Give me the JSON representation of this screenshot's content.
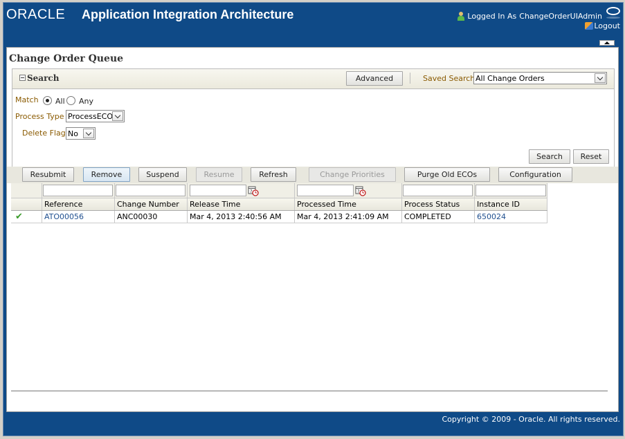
{
  "header": {
    "logo": "ORACLE",
    "app_title": "Application Integration Architecture",
    "logged_in_label": "Logged In As",
    "username": "ChangeOrderUIAdmin",
    "logout_label": "Logout"
  },
  "page": {
    "title": "Change Order Queue"
  },
  "search": {
    "title": "Search",
    "advanced_label": "Advanced",
    "saved_search_label": "Saved Search",
    "saved_search_value": "All Change Orders",
    "match_label": "Match",
    "match_options": [
      {
        "label": "All",
        "checked": true
      },
      {
        "label": "Any",
        "checked": false
      }
    ],
    "process_type_label": "Process Type",
    "process_type_value": "ProcessECO",
    "delete_flag_label": "Delete Flag",
    "delete_flag_value": "No",
    "search_button": "Search",
    "reset_button": "Reset"
  },
  "toolbar": {
    "buttons": [
      {
        "label": "Resubmit",
        "state": "normal"
      },
      {
        "label": "Remove",
        "state": "active"
      },
      {
        "label": "Suspend",
        "state": "normal"
      },
      {
        "label": "Resume",
        "state": "disabled"
      },
      {
        "label": "Refresh",
        "state": "normal"
      },
      {
        "label": "Change Priorities",
        "state": "disabled"
      },
      {
        "label": "Purge Old ECOs",
        "state": "normal"
      },
      {
        "label": "Configuration",
        "state": "normal"
      }
    ]
  },
  "table": {
    "columns": [
      "",
      "Reference",
      "Change Number",
      "Release Time",
      "Processed Time",
      "Process Status",
      "Instance ID"
    ],
    "rows": [
      {
        "status_icon": "check-icon",
        "status_glyph": "✔",
        "reference": "ATO00056",
        "change_number": "ANC00030",
        "release_time": "Mar 4, 2013 2:40:56 AM",
        "processed_time": "Mar 4, 2013 2:41:09 AM",
        "process_status": "COMPLETED",
        "instance_id": "650024"
      }
    ]
  },
  "footer": {
    "copyright": "Copyright © 2009 - Oracle. All rights reserved."
  },
  "colors": {
    "brand_blue": "#0f4a87",
    "label_brown": "#8a5a00",
    "link_blue": "#1f4f8f",
    "success_green": "#3a9a2a"
  }
}
